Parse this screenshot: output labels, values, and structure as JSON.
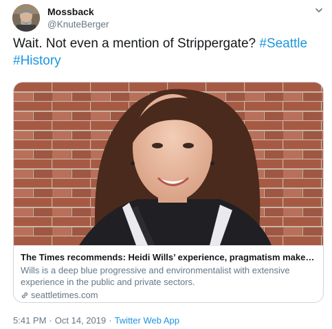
{
  "author": {
    "display_name": "Mossback",
    "handle": "@KnuteBerger"
  },
  "tweet": {
    "text_before": "Wait. Not even a mention of Strippergate? ",
    "hashtags": [
      "#Seattle",
      "#History"
    ]
  },
  "card": {
    "title": "The Times recommends: Heidi Wills’ experience, pragmatism make her the right ...",
    "description": "Wills is a deep blue progressive and environmentalist with extensive experience in the public and private sectors.",
    "domain": "seattletimes.com"
  },
  "meta": {
    "time": "5:41 PM",
    "separator": "·",
    "date": "Oct 14, 2019",
    "source": "Twitter Web App"
  },
  "icons": {
    "caret": "chevron-down-icon",
    "link": "link-icon"
  },
  "colors": {
    "link": "#1b95e0",
    "secondary_text": "#657786",
    "primary_text": "#14171a",
    "card_border": "#ccd6dd"
  }
}
